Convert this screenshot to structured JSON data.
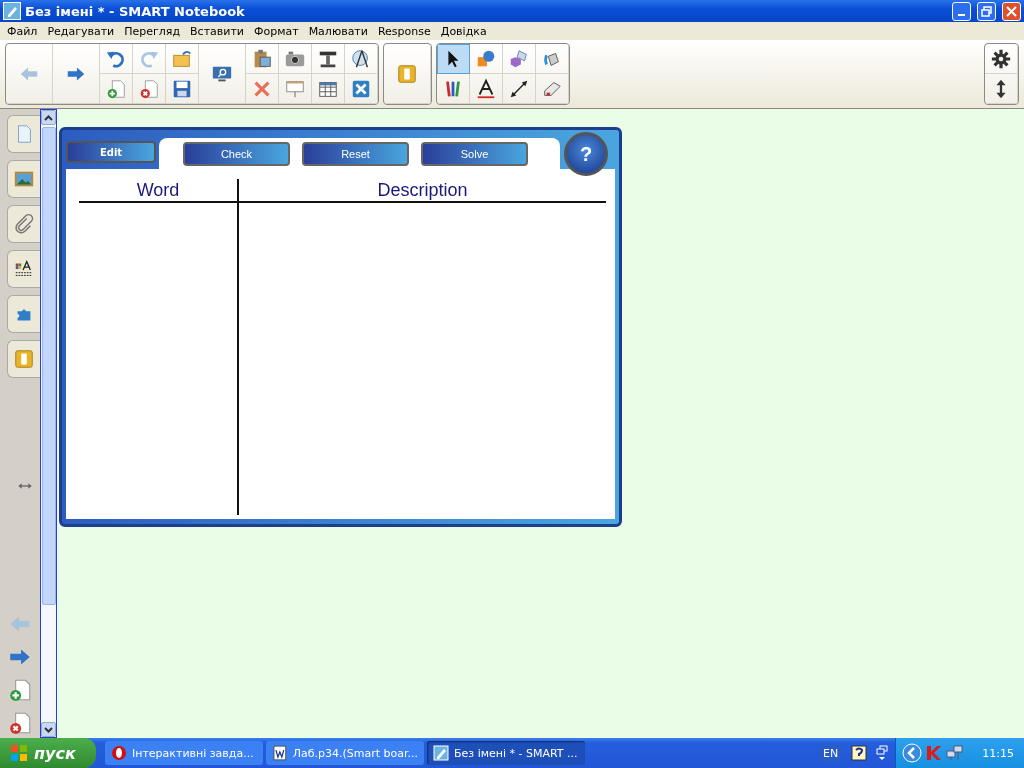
{
  "window": {
    "title": "Без імені * - SMART Notebook"
  },
  "menu": [
    "Файл",
    "Редагувати",
    "Перегляд",
    "Вставити",
    "Формат",
    "Малювати",
    "Response",
    "Довідка"
  ],
  "activity": {
    "edit_tab": "Edit",
    "buttons": [
      "Check",
      "Reset",
      "Solve"
    ],
    "help": "?",
    "columns": [
      "Word",
      "Description"
    ]
  },
  "taskbar": {
    "start": "пуск",
    "tasks": [
      {
        "label": "Інтерактивні завда...",
        "kind": "browser",
        "selected": false
      },
      {
        "label": "Лаб.р34.(Smart boar...",
        "kind": "document",
        "selected": false
      },
      {
        "label": "Без імені * - SMART ...",
        "kind": "notebook",
        "selected": true
      }
    ],
    "language": "EN",
    "clock": "11:15"
  }
}
